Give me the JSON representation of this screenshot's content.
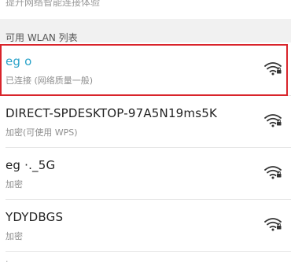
{
  "top_hint": "提升网络智能连接体验",
  "wlan_list": {
    "section_title": "可用 WLAN 列表",
    "networks": [
      {
        "name": "eg  o",
        "status": "已连接 (网络质量一般)",
        "connected": true,
        "signal_icon": "wifi-signal-locked-icon"
      },
      {
        "name": "DIRECT-SPDESKTOP-97A5N19ms5K",
        "status": "加密(可使用 WPS)",
        "connected": false,
        "signal_icon": "wifi-signal-locked-icon"
      },
      {
        "name": "eg ·._5G",
        "status": "加密",
        "connected": false,
        "signal_icon": "wifi-signal-locked-icon"
      },
      {
        "name": "YDYDBGS",
        "status": "加密",
        "connected": false,
        "signal_icon": "wifi-signal-locked-icon"
      }
    ]
  },
  "colors": {
    "connected_name": "#2aa3c9",
    "highlight": "#d9242b",
    "section_bg": "#f1f1f1"
  }
}
